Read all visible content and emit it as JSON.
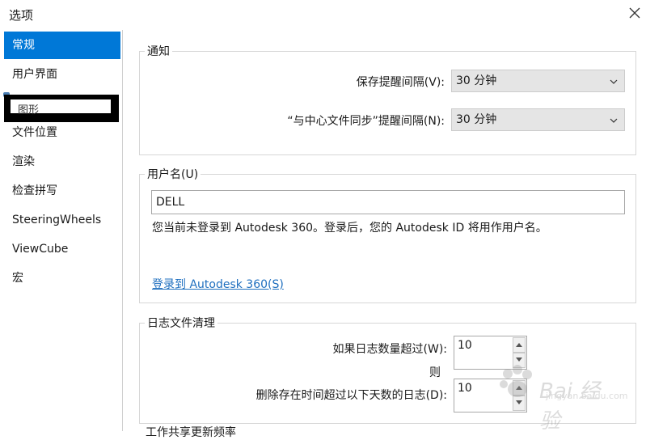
{
  "window": {
    "title": "选项"
  },
  "sidebar": {
    "items": [
      {
        "label": "常规",
        "selected": true
      },
      {
        "label": "用户界面"
      },
      {
        "label": "图形",
        "redacted": true
      },
      {
        "label": "文件位置"
      },
      {
        "label": "渲染"
      },
      {
        "label": "检查拼写"
      },
      {
        "label": "SteeringWheels"
      },
      {
        "label": "ViewCube"
      },
      {
        "label": "宏"
      }
    ]
  },
  "notify": {
    "title": "通知",
    "save_label": "保存提醒间隔(V):",
    "save_value": "30 分钟",
    "sync_label": "“与中心文件同步”提醒间隔(N):",
    "sync_value": "30 分钟"
  },
  "username": {
    "title": "用户名(U)",
    "value": "DELL",
    "info": "您当前未登录到 Autodesk 360。登录后，您的 Autodesk ID 将用作用户名。",
    "login_link": "登录到 Autodesk 360(S)"
  },
  "journal": {
    "title": "日志文件清理",
    "count_label": "如果日志数量超过(W):",
    "count_value": "10",
    "then_label": "则",
    "days_label": "删除存在时间超过以下天数的日志(D):",
    "days_value": "10"
  },
  "truncated_group": {
    "title": "工作共享更新频率"
  },
  "watermark": {
    "text": "Bai 经验",
    "url": "jingyan.baidu.com"
  },
  "colors": {
    "accent": "#0078d7",
    "link": "#1f6fbf"
  }
}
